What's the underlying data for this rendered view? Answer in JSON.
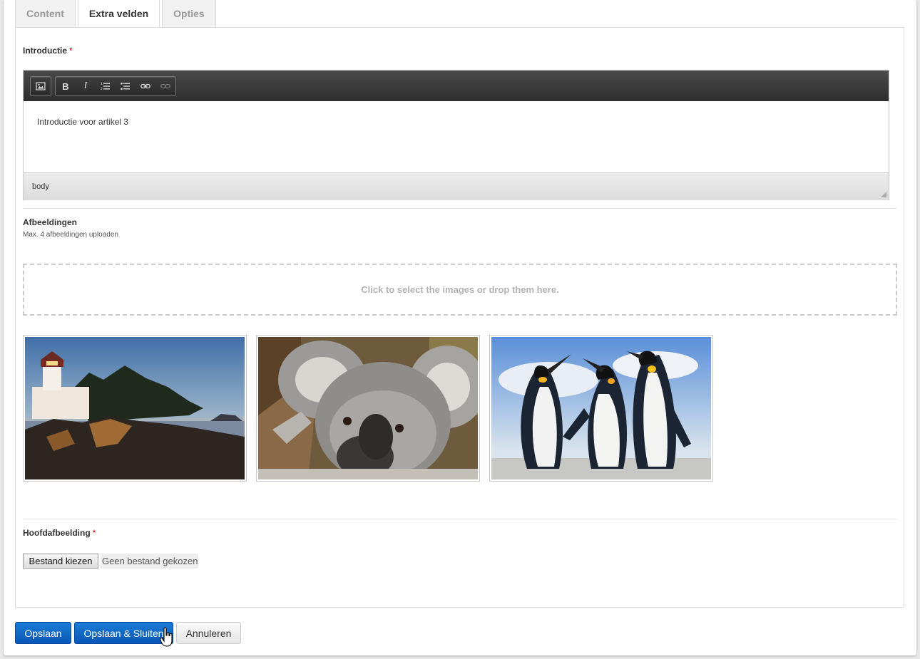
{
  "tabs": [
    {
      "label": "Content",
      "active": false
    },
    {
      "label": "Extra velden",
      "active": true
    },
    {
      "label": "Opties",
      "active": false
    }
  ],
  "intro": {
    "label": "Introductie",
    "required_mark": "*",
    "content": "Introductie voor artikel 3",
    "status_path": "body",
    "toolbar": {
      "buttons": [
        {
          "name": "image-icon"
        },
        {
          "name": "bold-icon",
          "label": "B"
        },
        {
          "name": "italic-icon",
          "label": "I"
        },
        {
          "name": "ordered-list-icon"
        },
        {
          "name": "unordered-list-icon"
        },
        {
          "name": "link-icon"
        },
        {
          "name": "unlink-icon",
          "disabled": true
        }
      ]
    }
  },
  "images": {
    "label": "Afbeeldingen",
    "hint": "Max. 4 afbeeldingen uploaden",
    "dropzone_text": "Click to select the images or drop them here.",
    "thumbnails": [
      {
        "name": "lighthouse"
      },
      {
        "name": "koala"
      },
      {
        "name": "penguins"
      }
    ]
  },
  "main_image": {
    "label": "Hoofdafbeelding",
    "required_mark": "*",
    "file_button": "Bestand kiezen",
    "file_status": "Geen bestand gekozen"
  },
  "actions": {
    "save": "Opslaan",
    "save_close": "Opslaan & Sluiten",
    "cancel": "Annuleren"
  },
  "colors": {
    "primary": "#0b56b4",
    "required": "#cc0000",
    "toolbar": "#2e2e2e"
  }
}
